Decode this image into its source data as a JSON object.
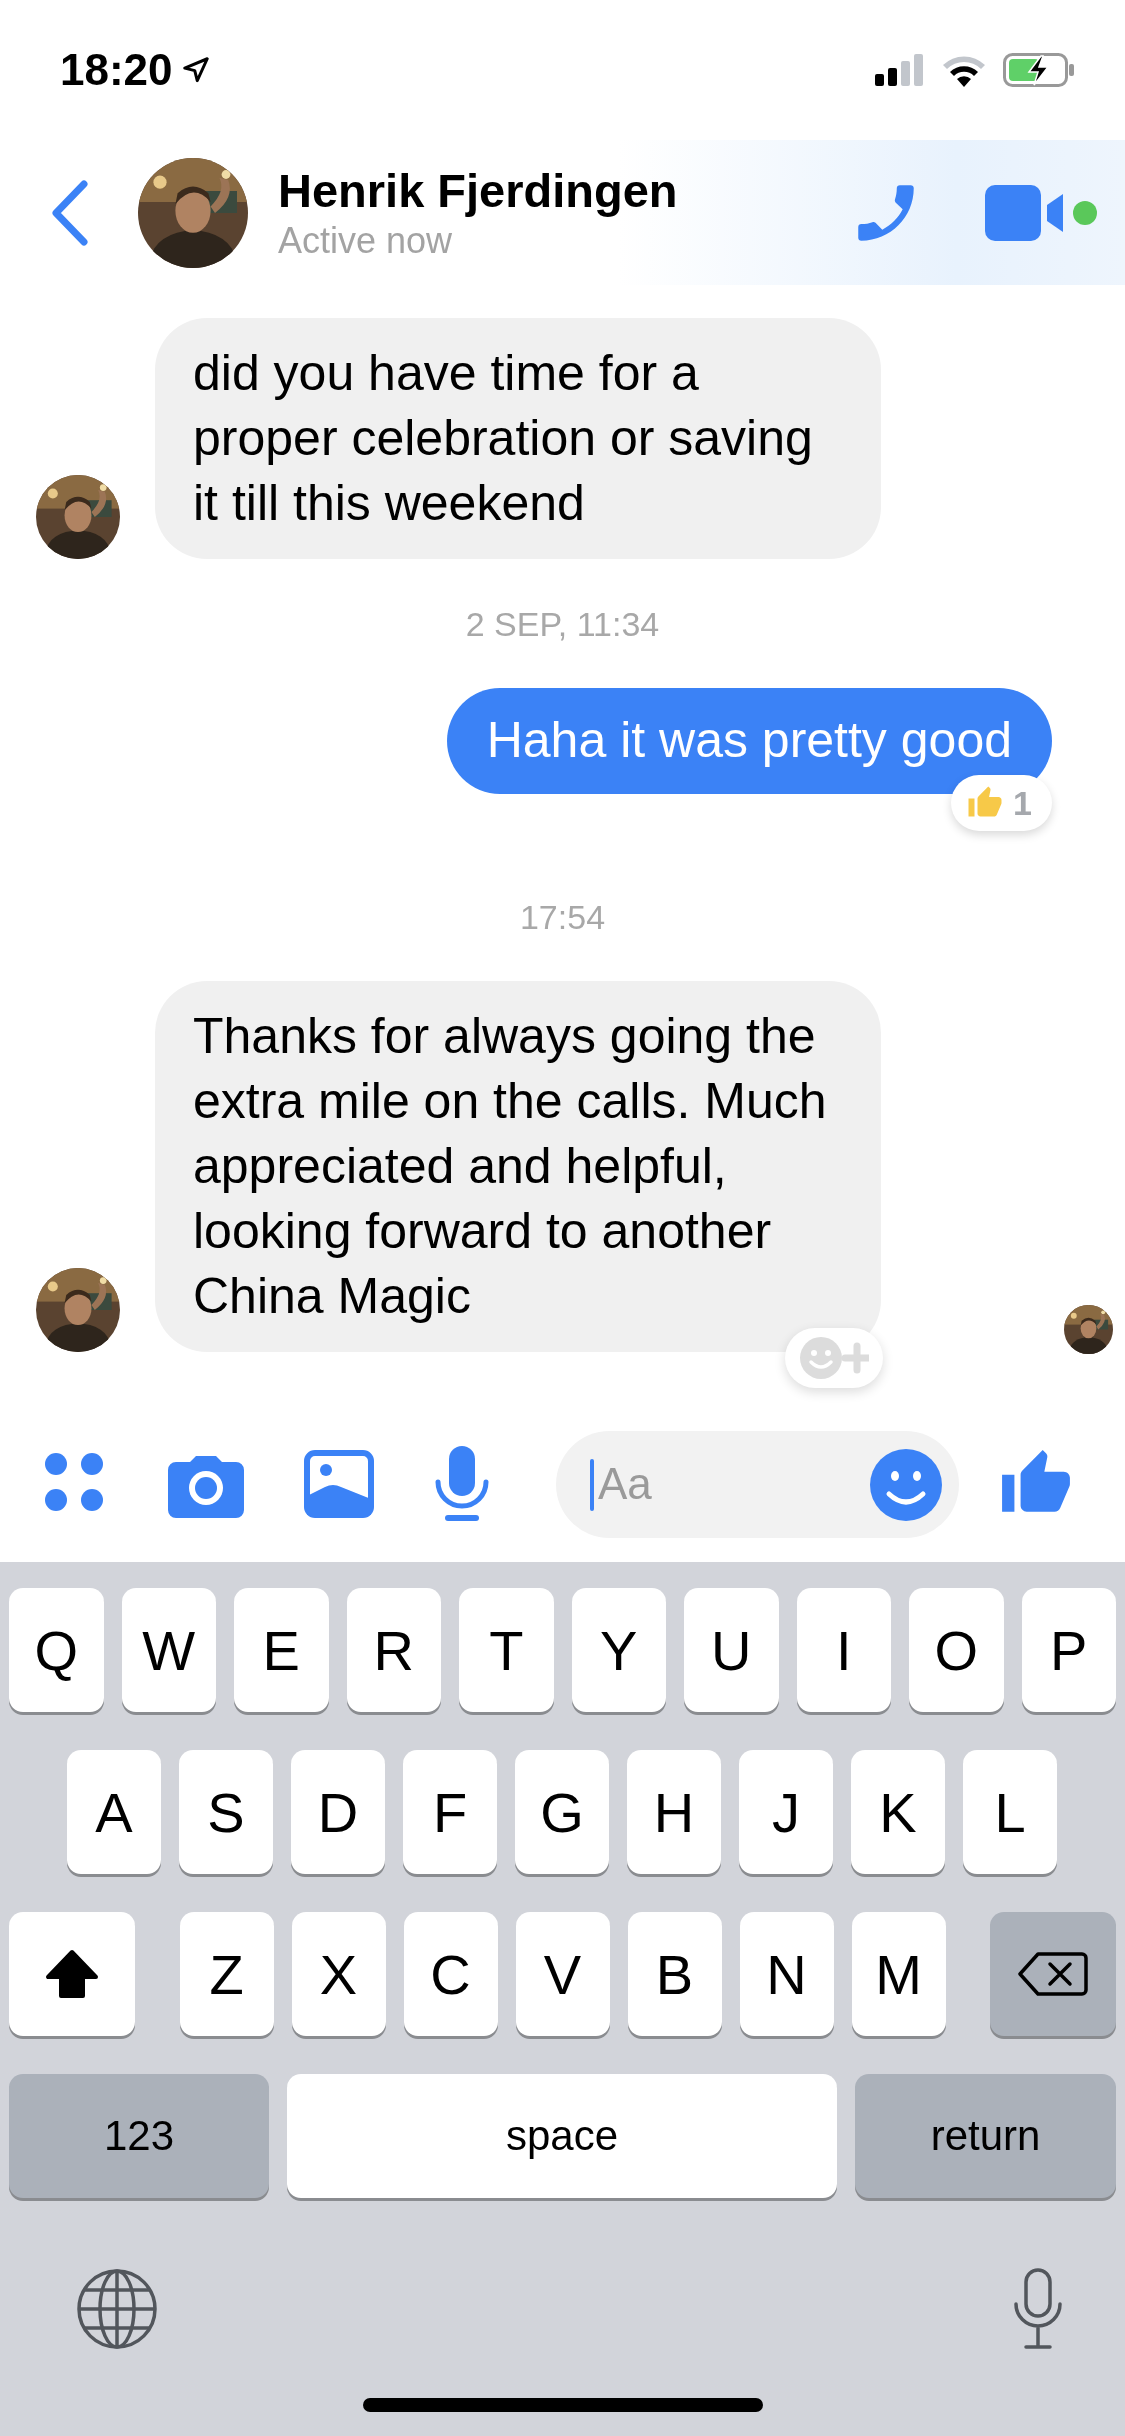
{
  "status_bar": {
    "time": "18:20"
  },
  "header": {
    "name": "Henrik Fjerdingen",
    "status": "Active now",
    "online": true
  },
  "messages": [
    {
      "kind": "incoming",
      "text": "did you have time for a proper celebration or saving it till this weekend",
      "seen": false,
      "add_reaction": false
    },
    {
      "kind": "timestamp",
      "text": "2 SEP, 11:34"
    },
    {
      "kind": "outgoing",
      "text": "Haha it was pretty good",
      "reaction_count": "1"
    },
    {
      "kind": "timestamp",
      "text": "17:54"
    },
    {
      "kind": "incoming",
      "text": "Thanks for always going the extra mile on the calls. Much appreciated and helpful, looking forward to another China Magic",
      "seen": true,
      "add_reaction": true
    }
  ],
  "composer": {
    "placeholder": "Aa"
  },
  "keyboard": {
    "rows": [
      [
        "Q",
        "W",
        "E",
        "R",
        "T",
        "Y",
        "U",
        "I",
        "O",
        "P"
      ],
      [
        "A",
        "S",
        "D",
        "F",
        "G",
        "H",
        "J",
        "K",
        "L"
      ],
      [
        "Z",
        "X",
        "C",
        "V",
        "B",
        "N",
        "M"
      ]
    ],
    "shift_on": true,
    "numbers_key": "123",
    "space_key": "space",
    "return_key": "return"
  }
}
